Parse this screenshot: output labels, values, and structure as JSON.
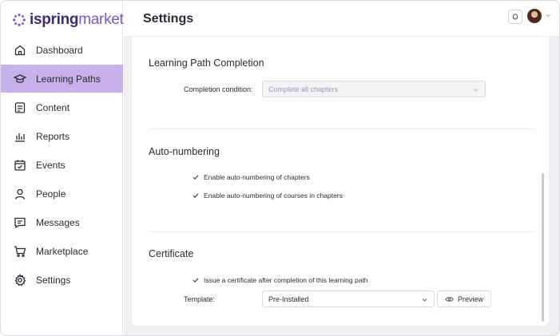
{
  "brand": {
    "part1": "ispring",
    "part2": "market"
  },
  "header": {
    "title": "Settings"
  },
  "sidebar": {
    "items": [
      {
        "label": "Dashboard",
        "icon": "home-icon",
        "active": false
      },
      {
        "label": "Learning Paths",
        "icon": "graduation-cap-icon",
        "active": true
      },
      {
        "label": "Content",
        "icon": "content-icon",
        "active": false
      },
      {
        "label": "Reports",
        "icon": "bar-chart-icon",
        "active": false
      },
      {
        "label": "Events",
        "icon": "calendar-check-icon",
        "active": false
      },
      {
        "label": "People",
        "icon": "person-icon",
        "active": false
      },
      {
        "label": "Messages",
        "icon": "message-icon",
        "active": false
      },
      {
        "label": "Marketplace",
        "icon": "cart-icon",
        "active": false
      },
      {
        "label": "Settings",
        "icon": "gear-icon",
        "active": false
      }
    ]
  },
  "completion": {
    "title": "Learning Path Completion",
    "condition_label": "Completion condition:",
    "condition_value": "Complete all chapters"
  },
  "autonumbering": {
    "title": "Auto-numbering",
    "opt1": "Enable auto-numbering of chapters",
    "opt2": "Enable auto-numbering of courses in chapters"
  },
  "certificate": {
    "title": "Certificate",
    "issue_label": "Issue a certificate after completion of this learning path",
    "template_label": "Template:",
    "template_value": "Pre-Installed",
    "preview_label": "Preview"
  },
  "colors": {
    "accent": "#c8b1ea",
    "brand_dark": "#3d2c73",
    "brand_light": "#7b59c9"
  }
}
